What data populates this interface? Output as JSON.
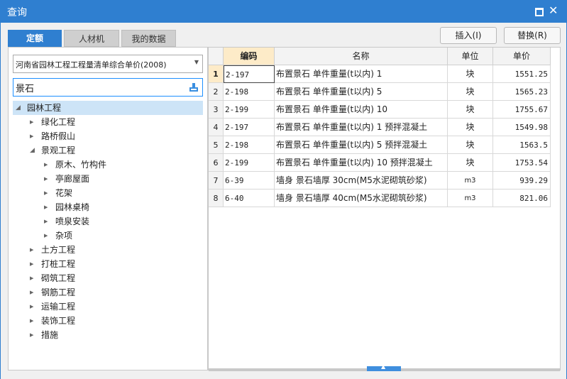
{
  "window": {
    "title": "查询"
  },
  "tabs": [
    {
      "label": "定额",
      "active": true
    },
    {
      "label": "人材机",
      "active": false
    },
    {
      "label": "我的数据",
      "active": false
    }
  ],
  "toolbar": {
    "insert_label": "插入(I)",
    "replace_label": "替换(R)"
  },
  "library": {
    "selected": "河南省园林工程工程量清单综合单价(2008)"
  },
  "search": {
    "value": "景石"
  },
  "tree": [
    {
      "label": "园林工程",
      "level": 0,
      "expanded": true,
      "selected": true
    },
    {
      "label": "绿化工程",
      "level": 1,
      "expanded": false
    },
    {
      "label": "路桥假山",
      "level": 1,
      "expanded": false
    },
    {
      "label": "景观工程",
      "level": 1,
      "expanded": true
    },
    {
      "label": "原木、竹构件",
      "level": 2,
      "expanded": false
    },
    {
      "label": "亭廊屋面",
      "level": 2,
      "expanded": false
    },
    {
      "label": "花架",
      "level": 2,
      "expanded": false
    },
    {
      "label": "园林桌椅",
      "level": 2,
      "expanded": false
    },
    {
      "label": "喷泉安装",
      "level": 2,
      "expanded": false
    },
    {
      "label": "杂项",
      "level": 2,
      "expanded": false
    },
    {
      "label": "土方工程",
      "level": 1,
      "expanded": false
    },
    {
      "label": "打桩工程",
      "level": 1,
      "expanded": false
    },
    {
      "label": "砌筑工程",
      "level": 1,
      "expanded": false
    },
    {
      "label": "钢筋工程",
      "level": 1,
      "expanded": false
    },
    {
      "label": "运输工程",
      "level": 1,
      "expanded": false
    },
    {
      "label": "装饰工程",
      "level": 1,
      "expanded": false
    },
    {
      "label": "措施",
      "level": 1,
      "expanded": false
    }
  ],
  "table": {
    "headers": [
      "编码",
      "名称",
      "单位",
      "单价"
    ],
    "rows": [
      {
        "no": "1",
        "code": "2-197",
        "name": "布置景石 单件重量(t以内) 1",
        "unit": "块",
        "price": "1551.25"
      },
      {
        "no": "2",
        "code": "2-198",
        "name": "布置景石 单件重量(t以内) 5",
        "unit": "块",
        "price": "1565.23"
      },
      {
        "no": "3",
        "code": "2-199",
        "name": "布置景石 单件重量(t以内) 10",
        "unit": "块",
        "price": "1755.67"
      },
      {
        "no": "4",
        "code": "2-197",
        "name": "布置景石 单件重量(t以内) 1 预拌混凝土",
        "unit": "块",
        "price": "1549.98"
      },
      {
        "no": "5",
        "code": "2-198",
        "name": "布置景石 单件重量(t以内) 5 预拌混凝土",
        "unit": "块",
        "price": "1563.5"
      },
      {
        "no": "6",
        "code": "2-199",
        "name": "布置景石 单件重量(t以内) 10 预拌混凝土",
        "unit": "块",
        "price": "1753.54"
      },
      {
        "no": "7",
        "code": "6-39",
        "name": "墙身 景石墙厚 30cm(M5水泥砌筑砂浆)",
        "unit": "m3",
        "price": "939.29"
      },
      {
        "no": "8",
        "code": "6-40",
        "name": "墙身 景石墙厚 40cm(M5水泥砌筑砂浆)",
        "unit": "m3",
        "price": "821.06"
      }
    ]
  }
}
